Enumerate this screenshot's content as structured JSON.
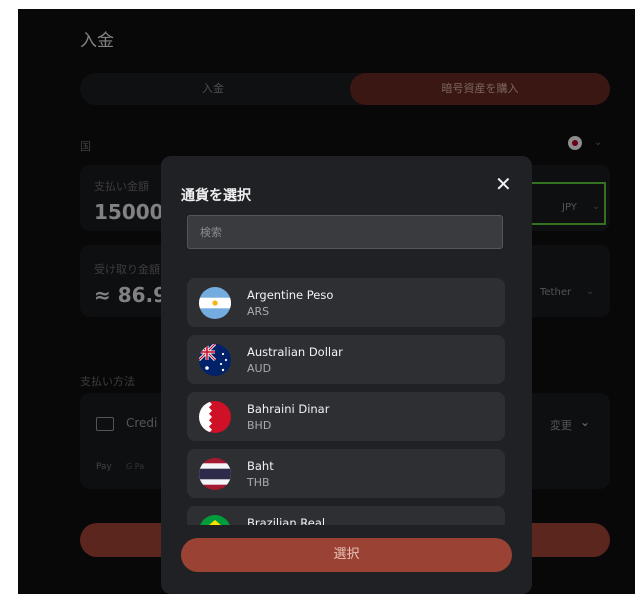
{
  "page": {
    "title": "入金"
  },
  "tabs": [
    {
      "label": "入金"
    },
    {
      "label": "暗号資産を購入"
    }
  ],
  "country": {
    "label": "国"
  },
  "pay_amount": {
    "label": "支払い金額",
    "value": "15000",
    "currency": "JPY"
  },
  "receive": {
    "label": "受け取り金額",
    "value": "≈ 86.9",
    "currency": "Tether"
  },
  "payment_method": {
    "label": "支払い方法",
    "card_label": "Credi",
    "change_label": "変更",
    "wallets": [
      "Pay",
      "G Pa"
    ]
  },
  "modal": {
    "title": "通貨を選択",
    "search_placeholder": "検索",
    "select_label": "選択",
    "currencies": [
      {
        "name": "Argentine Peso",
        "code": "ARS"
      },
      {
        "name": "Australian Dollar",
        "code": "AUD"
      },
      {
        "name": "Bahraini Dinar",
        "code": "BHD"
      },
      {
        "name": "Baht",
        "code": "THB"
      },
      {
        "name": "Brazilian Real",
        "code": ""
      }
    ]
  },
  "icons": {
    "close": "close-icon",
    "chevron": "chevron-down-icon",
    "card": "credit-card-icon",
    "flags": [
      "argentina-flag-icon",
      "australia-flag-icon",
      "bahrain-flag-icon",
      "thailand-flag-icon",
      "brazil-flag-icon",
      "japan-flag-icon"
    ]
  },
  "colors": {
    "accent": "#9a4335",
    "highlight_box": "#5fcf3a",
    "background": "#101012",
    "modal": "#202124"
  }
}
